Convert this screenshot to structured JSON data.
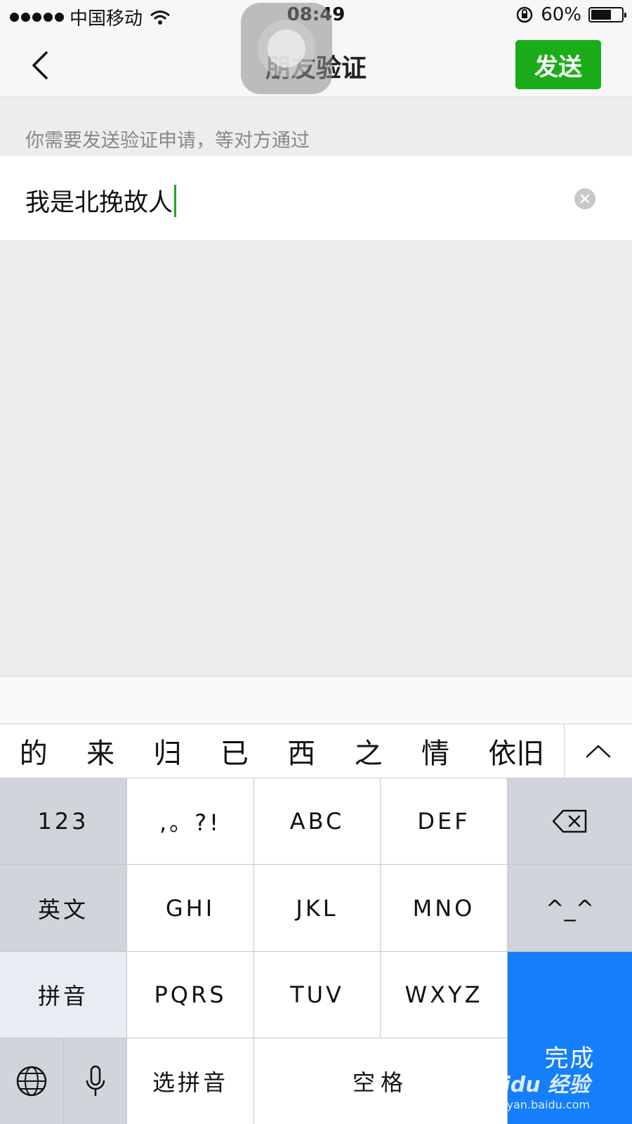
{
  "status_bar": {
    "carrier": "中国移动",
    "time": "08:49",
    "battery": "60%",
    "battery_level": 0.6
  },
  "nav": {
    "title": "朋友验证",
    "send_label": "发送"
  },
  "hint": "你需要发送验证申请，等对方通过",
  "input": {
    "value": "我是北挽故人"
  },
  "candidates": [
    "的",
    "来",
    "归",
    "已",
    "西",
    "之",
    "情",
    "依旧"
  ],
  "keyboard": {
    "numbers": "123",
    "punct": ",。?!",
    "abc": "ABC",
    "def": "DEF",
    "english": "英文",
    "ghi": "GHI",
    "jkl": "JKL",
    "mno": "MNO",
    "emoticon": "^_^",
    "pinyin": "拼音",
    "pqrs": "PQRS",
    "tuv": "TUV",
    "wxyz": "WXYZ",
    "done": "完成",
    "select_pinyin": "选拼音",
    "space": "空格"
  },
  "watermark": {
    "brand": "Baidu 经验",
    "url": "jingyan.baidu.com"
  },
  "colors": {
    "accent_green": "#1aad19",
    "done_blue": "#147efb"
  },
  "icons": [
    "back-chevron-icon",
    "wifi-icon",
    "rotation-lock-icon",
    "battery-icon",
    "clear-icon",
    "chevron-up-icon",
    "backspace-icon",
    "globe-icon",
    "microphone-icon"
  ]
}
